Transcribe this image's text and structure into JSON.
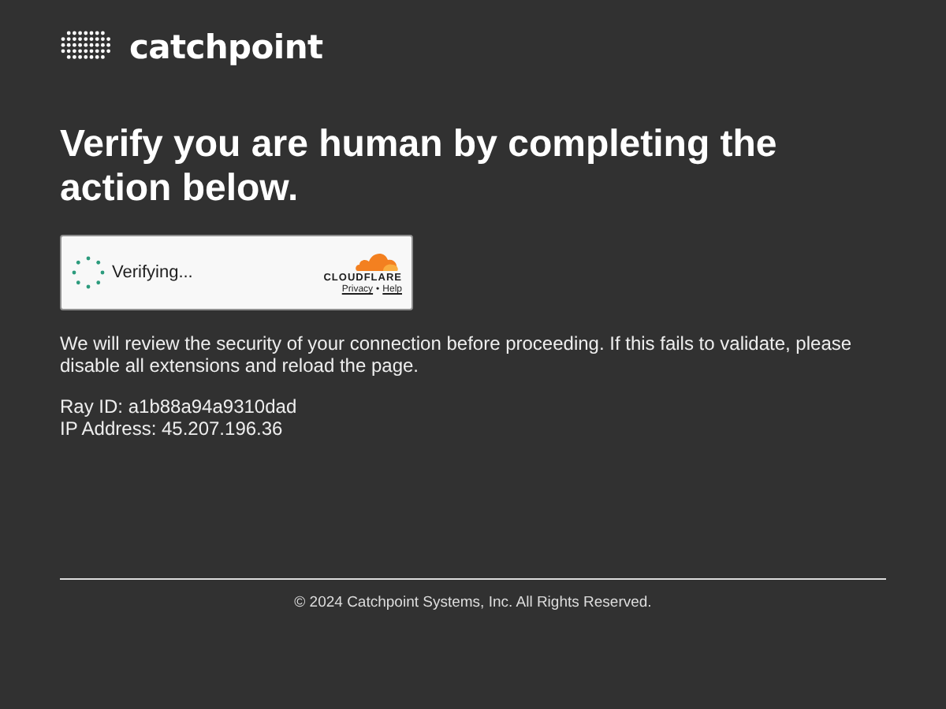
{
  "logo": {
    "text": "catchpoint"
  },
  "heading": "Verify you are human by completing the action below.",
  "widget": {
    "status": "Verifying...",
    "brand": "CLOUDFLARE",
    "links": [
      "Privacy",
      "Help"
    ],
    "separator": "•"
  },
  "message": "We will review the security of your connection before proceeding. If this fails to validate, please disable all extensions and reload the page.",
  "details": [
    "Ray ID: a1b88a94a9310dad",
    "IP Address: 45.207.196.36"
  ],
  "footer": "© 2024 Catchpoint Systems, Inc. All Rights Reserved."
}
